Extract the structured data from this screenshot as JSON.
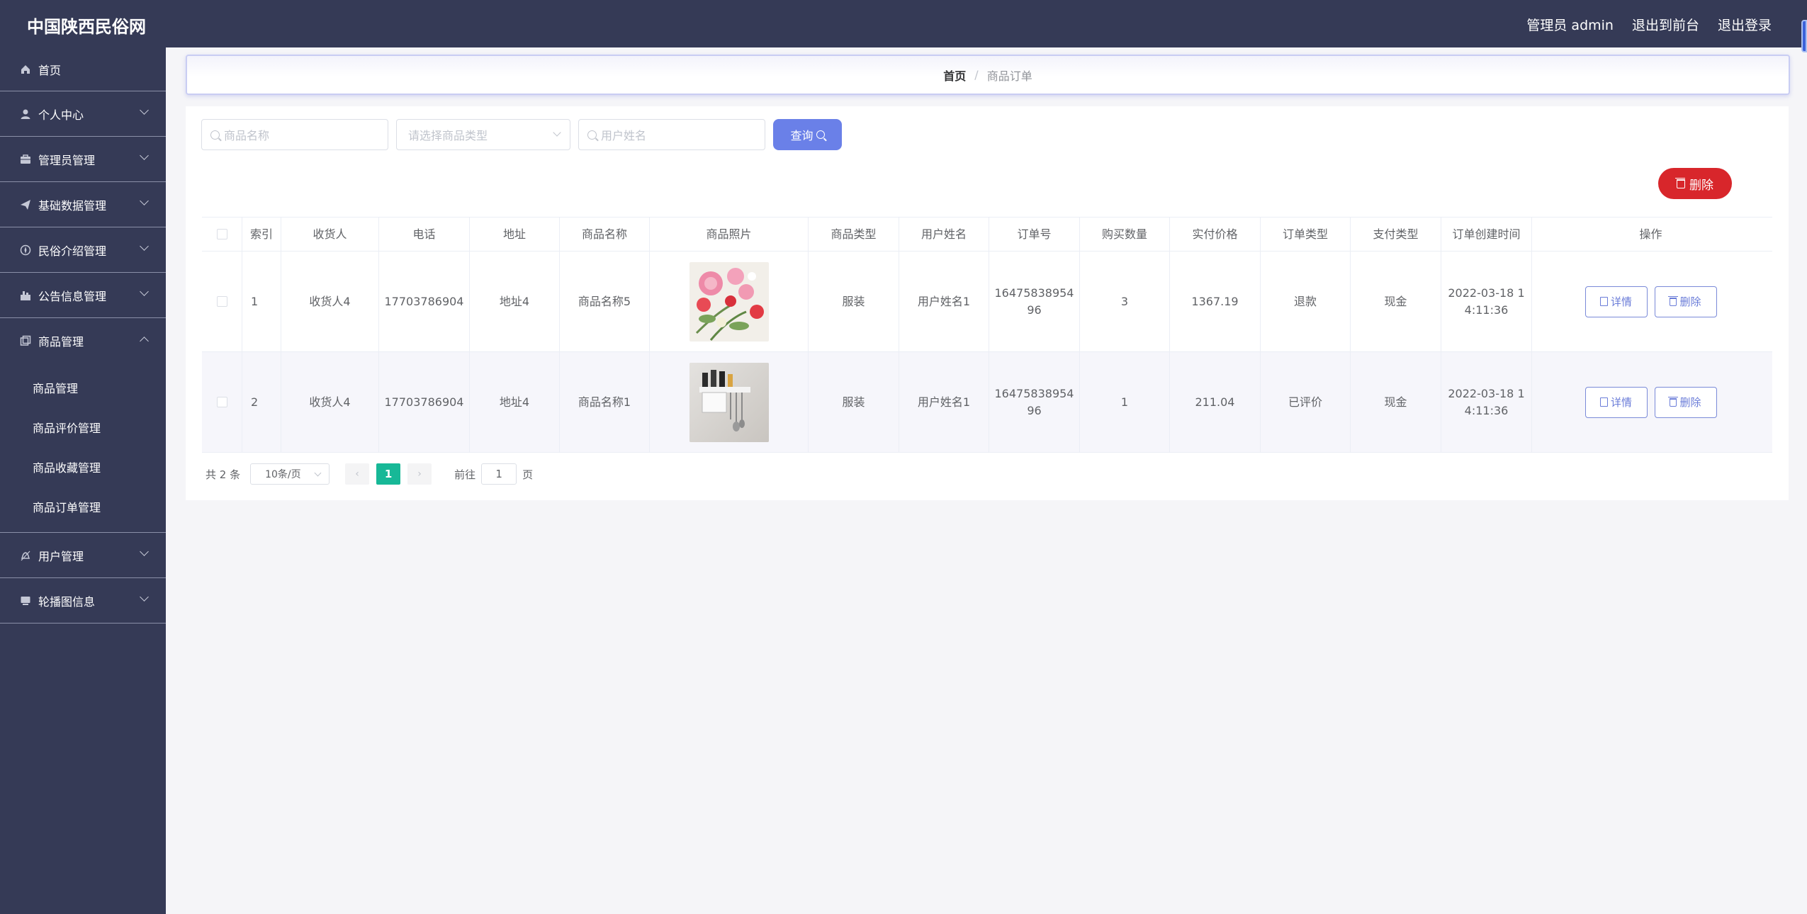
{
  "app": {
    "brand": "中国陕西民俗网"
  },
  "header": {
    "user_label": "管理员 admin",
    "to_front": "退出到前台",
    "logout": "退出登录"
  },
  "sidebar": {
    "home": "首页",
    "items": [
      {
        "label": "个人中心",
        "icon": "user-icon"
      },
      {
        "label": "管理员管理",
        "icon": "briefcase-icon"
      },
      {
        "label": "基础数据管理",
        "icon": "paper-plane-icon"
      },
      {
        "label": "民俗介绍管理",
        "icon": "compass-icon"
      },
      {
        "label": "公告信息管理",
        "icon": "notice-icon"
      },
      {
        "label": "商品管理",
        "icon": "goods-icon",
        "expanded": true
      }
    ],
    "goods_sub": [
      "商品管理",
      "商品评价管理",
      "商品收藏管理",
      "商品订单管理"
    ],
    "after": [
      {
        "label": "用户管理",
        "icon": "bell-icon"
      },
      {
        "label": "轮播图信息",
        "icon": "monitor-icon"
      }
    ]
  },
  "breadcrumb": {
    "home": "首页",
    "sep": "/",
    "current": "商品订单"
  },
  "search": {
    "goods_name_placeholder": "商品名称",
    "goods_type_placeholder": "请选择商品类型",
    "user_name_placeholder": "用户姓名",
    "query_label": "查询"
  },
  "actions": {
    "delete_label": "删除"
  },
  "table": {
    "headers": [
      "索引",
      "收货人",
      "电话",
      "地址",
      "商品名称",
      "商品照片",
      "商品类型",
      "用户姓名",
      "订单号",
      "购买数量",
      "实付价格",
      "订单类型",
      "支付类型",
      "订单创建时间",
      "操作"
    ],
    "rows": [
      {
        "index": "1",
        "receiver": "收货人4",
        "phone": "17703786904",
        "address": "地址4",
        "goods_name": "商品名称5",
        "photo": "flowers-photo",
        "goods_type": "服装",
        "user_name": "用户姓名1",
        "order_no_1": "16475838954",
        "order_no_2": "96",
        "qty": "3",
        "price": "1367.19",
        "order_type": "退款",
        "pay_type": "现金",
        "created_1": "2022-03-18 1",
        "created_2": "4:11:36",
        "detail_label": "详情",
        "delete_label": "删除"
      },
      {
        "index": "2",
        "receiver": "收货人4",
        "phone": "17703786904",
        "address": "地址4",
        "goods_name": "商品名称1",
        "photo": "kitchen-rack-photo",
        "goods_type": "服装",
        "user_name": "用户姓名1",
        "order_no_1": "16475838954",
        "order_no_2": "96",
        "qty": "1",
        "price": "211.04",
        "order_type": "已评价",
        "pay_type": "现金",
        "created_1": "2022-03-18 1",
        "created_2": "4:11:36",
        "detail_label": "详情",
        "delete_label": "删除"
      }
    ]
  },
  "pagination": {
    "total": "共 2 条",
    "page_size": "10条/页",
    "current": "1",
    "goto_label": "前往",
    "goto_value": "1",
    "page_suffix": "页"
  },
  "colors": {
    "sidebar_bg": "#353a56",
    "primary": "#6a80e8",
    "danger": "#d8262b",
    "pager_active": "#17b897"
  }
}
